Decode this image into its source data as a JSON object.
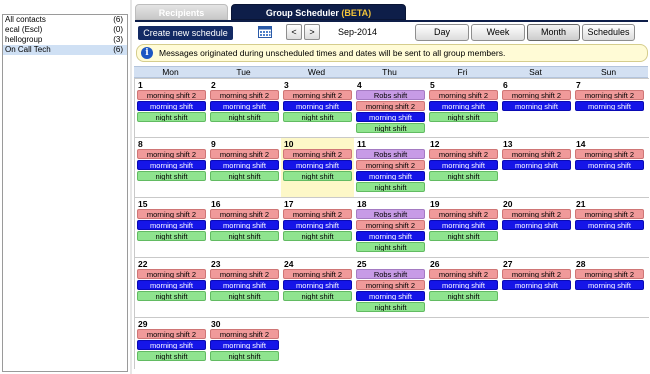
{
  "contacts": [
    {
      "name": "All contacts",
      "count": "(6)"
    },
    {
      "name": "ecal (Escl)",
      "count": "(0)"
    },
    {
      "name": "hellogroup",
      "count": "(3)"
    },
    {
      "name": "On Call Tech",
      "count": "(6)",
      "selected": true
    }
  ],
  "tabs": {
    "recipients": "Recipients",
    "group_scheduler": "Group Scheduler",
    "beta": "(BETA)"
  },
  "toolbar": {
    "create_label": "Create new schedule",
    "prev_label": "<",
    "next_label": ">",
    "month_label": "Sep-2014",
    "view_day": "Day",
    "view_week": "Week",
    "view_month": "Month",
    "view_schedules": "Schedules",
    "active_view": "Month"
  },
  "info": {
    "icon": "i",
    "text": "Messages originated during unscheduled times and dates will be sent to all group members."
  },
  "day_names": [
    "Mon",
    "Tue",
    "Wed",
    "Thu",
    "Fri",
    "Sat",
    "Sun"
  ],
  "colors": {
    "pink": "#f09a9a",
    "blue": "#1515e8",
    "green": "#8fe48f",
    "purple": "#c79be6",
    "today": "#fdf8c8"
  },
  "weeks": [
    [
      {
        "day": "1",
        "events": [
          {
            "t": "morning shift 2",
            "c": "pink"
          },
          {
            "t": "morning shift",
            "c": "blue"
          },
          {
            "t": "night shift",
            "c": "green"
          }
        ]
      },
      {
        "day": "2",
        "events": [
          {
            "t": "morning shift 2",
            "c": "pink"
          },
          {
            "t": "morning shift",
            "c": "blue"
          },
          {
            "t": "night shift",
            "c": "green"
          }
        ]
      },
      {
        "day": "3",
        "events": [
          {
            "t": "morning shift 2",
            "c": "pink"
          },
          {
            "t": "morning shift",
            "c": "blue"
          },
          {
            "t": "night shift",
            "c": "green"
          }
        ]
      },
      {
        "day": "4",
        "events": [
          {
            "t": "Robs shift",
            "c": "purple"
          },
          {
            "t": "morning shift 2",
            "c": "pink"
          },
          {
            "t": "morning shift",
            "c": "blue"
          },
          {
            "t": "night shift",
            "c": "green"
          }
        ]
      },
      {
        "day": "5",
        "events": [
          {
            "t": "morning shift 2",
            "c": "pink"
          },
          {
            "t": "morning shift",
            "c": "blue"
          },
          {
            "t": "night shift",
            "c": "green"
          }
        ]
      },
      {
        "day": "6",
        "events": [
          {
            "t": "morning shift 2",
            "c": "pink"
          },
          {
            "t": "morning shift",
            "c": "blue"
          }
        ]
      },
      {
        "day": "7",
        "events": [
          {
            "t": "morning shift 2",
            "c": "pink"
          },
          {
            "t": "morning shift",
            "c": "blue"
          }
        ]
      }
    ],
    [
      {
        "day": "8",
        "events": [
          {
            "t": "morning shift 2",
            "c": "pink"
          },
          {
            "t": "morning shift",
            "c": "blue"
          },
          {
            "t": "night shift",
            "c": "green"
          }
        ]
      },
      {
        "day": "9",
        "events": [
          {
            "t": "morning shift 2",
            "c": "pink"
          },
          {
            "t": "morning shift",
            "c": "blue"
          },
          {
            "t": "night shift",
            "c": "green"
          }
        ]
      },
      {
        "day": "10",
        "today": true,
        "events": [
          {
            "t": "morning shift 2",
            "c": "pink"
          },
          {
            "t": "morning shift",
            "c": "blue"
          },
          {
            "t": "night shift",
            "c": "green"
          }
        ]
      },
      {
        "day": "11",
        "events": [
          {
            "t": "Robs shift",
            "c": "purple"
          },
          {
            "t": "morning shift 2",
            "c": "pink"
          },
          {
            "t": "morning shift",
            "c": "blue"
          },
          {
            "t": "night shift",
            "c": "green"
          }
        ]
      },
      {
        "day": "12",
        "events": [
          {
            "t": "morning shift 2",
            "c": "pink"
          },
          {
            "t": "morning shift",
            "c": "blue"
          },
          {
            "t": "night shift",
            "c": "green"
          }
        ]
      },
      {
        "day": "13",
        "events": [
          {
            "t": "morning shift 2",
            "c": "pink"
          },
          {
            "t": "morning shift",
            "c": "blue"
          }
        ]
      },
      {
        "day": "14",
        "events": [
          {
            "t": "morning shift 2",
            "c": "pink"
          },
          {
            "t": "morning shift",
            "c": "blue"
          }
        ]
      }
    ],
    [
      {
        "day": "15",
        "events": [
          {
            "t": "morning shift 2",
            "c": "pink"
          },
          {
            "t": "morning shift",
            "c": "blue"
          },
          {
            "t": "night shift",
            "c": "green"
          }
        ]
      },
      {
        "day": "16",
        "events": [
          {
            "t": "morning shift 2",
            "c": "pink"
          },
          {
            "t": "morning shift",
            "c": "blue"
          },
          {
            "t": "night shift",
            "c": "green"
          }
        ]
      },
      {
        "day": "17",
        "events": [
          {
            "t": "morning shift 2",
            "c": "pink"
          },
          {
            "t": "morning shift",
            "c": "blue"
          },
          {
            "t": "night shift",
            "c": "green"
          }
        ]
      },
      {
        "day": "18",
        "events": [
          {
            "t": "Robs shift",
            "c": "purple"
          },
          {
            "t": "morning shift 2",
            "c": "pink"
          },
          {
            "t": "morning shift",
            "c": "blue"
          },
          {
            "t": "night shift",
            "c": "green"
          }
        ]
      },
      {
        "day": "19",
        "events": [
          {
            "t": "morning shift 2",
            "c": "pink"
          },
          {
            "t": "morning shift",
            "c": "blue"
          },
          {
            "t": "night shift",
            "c": "green"
          }
        ]
      },
      {
        "day": "20",
        "events": [
          {
            "t": "morning shift 2",
            "c": "pink"
          },
          {
            "t": "morning shift",
            "c": "blue"
          }
        ]
      },
      {
        "day": "21",
        "events": [
          {
            "t": "morning shift 2",
            "c": "pink"
          },
          {
            "t": "morning shift",
            "c": "blue"
          }
        ]
      }
    ],
    [
      {
        "day": "22",
        "events": [
          {
            "t": "morning shift 2",
            "c": "pink"
          },
          {
            "t": "morning shift",
            "c": "blue"
          },
          {
            "t": "night shift",
            "c": "green"
          }
        ]
      },
      {
        "day": "23",
        "events": [
          {
            "t": "morning shift 2",
            "c": "pink"
          },
          {
            "t": "morning shift",
            "c": "blue"
          },
          {
            "t": "night shift",
            "c": "green"
          }
        ]
      },
      {
        "day": "24",
        "events": [
          {
            "t": "morning shift 2",
            "c": "pink"
          },
          {
            "t": "morning shift",
            "c": "blue"
          },
          {
            "t": "night shift",
            "c": "green"
          }
        ]
      },
      {
        "day": "25",
        "events": [
          {
            "t": "Robs shift",
            "c": "purple"
          },
          {
            "t": "morning shift 2",
            "c": "pink"
          },
          {
            "t": "morning shift",
            "c": "blue"
          },
          {
            "t": "night shift",
            "c": "green"
          }
        ]
      },
      {
        "day": "26",
        "events": [
          {
            "t": "morning shift 2",
            "c": "pink"
          },
          {
            "t": "morning shift",
            "c": "blue"
          },
          {
            "t": "night shift",
            "c": "green"
          }
        ]
      },
      {
        "day": "27",
        "events": [
          {
            "t": "morning shift 2",
            "c": "pink"
          },
          {
            "t": "morning shift",
            "c": "blue"
          }
        ]
      },
      {
        "day": "28",
        "events": [
          {
            "t": "morning shift 2",
            "c": "pink"
          },
          {
            "t": "morning shift",
            "c": "blue"
          }
        ]
      }
    ],
    [
      {
        "day": "29",
        "events": [
          {
            "t": "morning shift 2",
            "c": "pink"
          },
          {
            "t": "morning shift",
            "c": "blue"
          },
          {
            "t": "night shift",
            "c": "green"
          }
        ]
      },
      {
        "day": "30",
        "events": [
          {
            "t": "morning shift 2",
            "c": "pink"
          },
          {
            "t": "morning shift",
            "c": "blue"
          },
          {
            "t": "night shift",
            "c": "green"
          }
        ]
      },
      {
        "day": "",
        "events": []
      },
      {
        "day": "",
        "events": []
      },
      {
        "day": "",
        "events": []
      },
      {
        "day": "",
        "events": []
      },
      {
        "day": "",
        "events": []
      }
    ]
  ]
}
